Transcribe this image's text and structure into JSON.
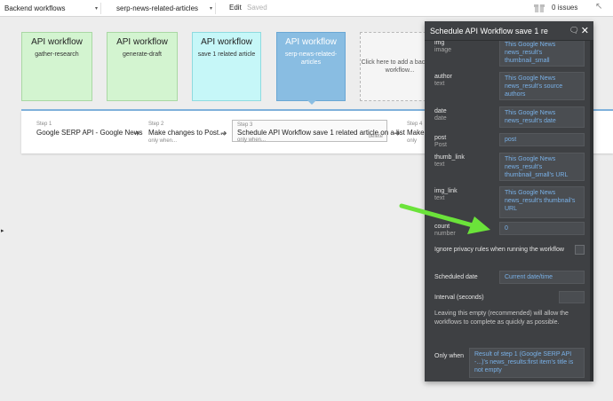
{
  "topbar": {
    "page_select": "Backend workflows",
    "workflow_select": "serp-news-related-articles",
    "edit": "Edit",
    "saved": "Saved",
    "issues": "0 issues"
  },
  "cards": [
    {
      "title": "API workflow",
      "subtitle": "gather-research"
    },
    {
      "title": "API workflow",
      "subtitle": "generate-draft"
    },
    {
      "title": "API workflow",
      "subtitle": "save 1 related article"
    },
    {
      "title": "API workflow",
      "subtitle": "serp-news-related-articles"
    },
    {
      "title": "",
      "subtitle": "Click here to add a backend workflow..."
    }
  ],
  "steps": [
    {
      "num": "Step 1",
      "label": "Google SERP API - Google News",
      "when": ""
    },
    {
      "num": "Step 2",
      "label": "Make changes to Post...",
      "when": "only when..."
    },
    {
      "num": "Step 3",
      "label": "Schedule API Workflow save 1 related article on a list",
      "when": "only when...",
      "delete": "delete"
    },
    {
      "num": "Step 4",
      "label": "Make",
      "when": "only"
    }
  ],
  "panel": {
    "title": "Schedule API Workflow save 1 re",
    "fields": [
      {
        "label": "img",
        "type": "image",
        "value": "This Google News news_result's thumbnail_small"
      },
      {
        "label": "author",
        "type": "text",
        "value": "This Google News news_result's source authors"
      },
      {
        "label": "date",
        "type": "date",
        "value": "This Google News news_result's date"
      },
      {
        "label": "post",
        "type": "Post",
        "value": "post"
      },
      {
        "label": "thumb_link",
        "type": "text",
        "value": "This Google News news_result's thumbnail_small's URL"
      },
      {
        "label": "img_link",
        "type": "text",
        "value": "This Google News news_result's thumbnail's URL"
      },
      {
        "label": "count",
        "type": "number",
        "value": "0"
      }
    ],
    "ignore_privacy": "Ignore privacy rules when running the workflow",
    "scheduled_date_label": "Scheduled date",
    "scheduled_date_value": "Current date/time",
    "interval_label": "Interval (seconds)",
    "interval_note": "Leaving this empty (recommended) will allow the workflows to complete as quickly as possible.",
    "only_when_label": "Only when",
    "only_when_value": "Result of step 1 (Google SERP API -...)'s news_results:first item's title is not empty"
  },
  "colors": {
    "panel_bg": "#3e4043",
    "link_blue": "#79b1e8",
    "annotation_green": "#6be33a",
    "selected_card": "#89bde2"
  }
}
